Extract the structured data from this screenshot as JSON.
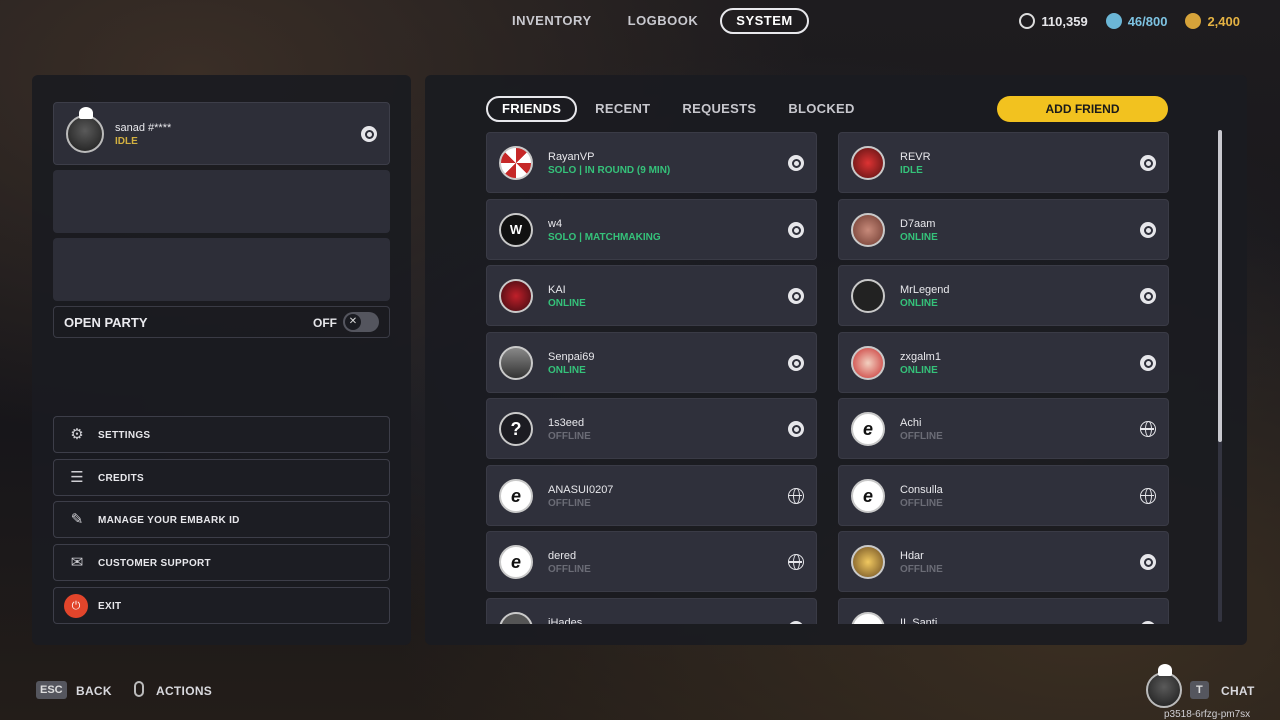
{
  "nav": {
    "tabs": [
      {
        "label": "INVENTORY",
        "active": false
      },
      {
        "label": "LOGBOOK",
        "active": false
      },
      {
        "label": "SYSTEM",
        "active": true
      }
    ]
  },
  "currencies": {
    "credits": {
      "value": "110,359",
      "icon": "coin-icon"
    },
    "capacity": {
      "value": "46/800",
      "icon": "storage-icon",
      "color": "#7ec3e2"
    },
    "premium": {
      "value": "2,400",
      "icon": "multibucks-icon",
      "color": "#e4b243"
    }
  },
  "party": {
    "player": {
      "name": "sanad #****",
      "status": "IDLE",
      "platform": "steam-icon"
    },
    "open_party_label": "OPEN PARTY",
    "open_party_state": "OFF",
    "toggle_icon": "✕"
  },
  "menu": [
    {
      "label": "SETTINGS",
      "icon": "⚙",
      "name": "settings-button",
      "icon_name": "gear-icon"
    },
    {
      "label": "CREDITS",
      "icon": "☰",
      "name": "credits-button",
      "icon_name": "list-icon"
    },
    {
      "label": "MANAGE YOUR EMBARK ID",
      "icon": "✎",
      "name": "manage-embark-id-button",
      "icon_name": "pen-icon"
    },
    {
      "label": "CUSTOMER SUPPORT",
      "icon": "✉",
      "name": "customer-support-button",
      "icon_name": "chat-bubbles-icon"
    },
    {
      "label": "EXIT",
      "icon": "⏻",
      "name": "exit-button",
      "icon_name": "power-icon"
    }
  ],
  "friends_tabs": [
    {
      "label": "FRIENDS",
      "active": true
    },
    {
      "label": "RECENT",
      "active": false
    },
    {
      "label": "REQUESTS",
      "active": false
    },
    {
      "label": "BLOCKED",
      "active": false
    }
  ],
  "add_friend_label": "ADD FRIEND",
  "friends": [
    {
      "name": "RayanVP",
      "status": "SOLO | IN ROUND (9 MIN)",
      "state": "online",
      "platform": "steam",
      "avatar": "umbrella",
      "glyph": ""
    },
    {
      "name": "REVR",
      "status": "IDLE",
      "state": "idle",
      "platform": "steam",
      "avatar": "revr",
      "glyph": ""
    },
    {
      "name": "w4",
      "status": "SOLO | MATCHMAKING",
      "state": "online",
      "platform": "steam",
      "avatar": "w4",
      "glyph": "W"
    },
    {
      "name": "D7aam",
      "status": "ONLINE",
      "state": "online",
      "platform": "steam",
      "avatar": "d7",
      "glyph": ""
    },
    {
      "name": "KAI",
      "status": "ONLINE",
      "state": "online",
      "platform": "steam",
      "avatar": "kai",
      "glyph": ""
    },
    {
      "name": "MrLegend",
      "status": "ONLINE",
      "state": "online",
      "platform": "steam",
      "avatar": "mr",
      "glyph": ""
    },
    {
      "name": "Senpai69",
      "status": "ONLINE",
      "state": "online",
      "platform": "steam",
      "avatar": "senpai",
      "glyph": ""
    },
    {
      "name": "zxgalm1",
      "status": "ONLINE",
      "state": "online",
      "platform": "steam",
      "avatar": "zx",
      "glyph": ""
    },
    {
      "name": "1s3eed",
      "status": "OFFLINE",
      "state": "offline",
      "platform": "steam",
      "avatar": "q",
      "glyph": "?"
    },
    {
      "name": "Achi",
      "status": "OFFLINE",
      "state": "offline",
      "platform": "globe",
      "avatar": "e",
      "glyph": "e"
    },
    {
      "name": "ANASUI0207",
      "status": "OFFLINE",
      "state": "offline",
      "platform": "globe",
      "avatar": "e",
      "glyph": "e"
    },
    {
      "name": "Consulla",
      "status": "OFFLINE",
      "state": "offline",
      "platform": "globe",
      "avatar": "e",
      "glyph": "e"
    },
    {
      "name": "dered",
      "status": "OFFLINE",
      "state": "offline",
      "platform": "globe",
      "avatar": "e",
      "glyph": "e"
    },
    {
      "name": "Hdar",
      "status": "OFFLINE",
      "state": "offline",
      "platform": "steam",
      "avatar": "hdar",
      "glyph": ""
    },
    {
      "name": "iHades",
      "status": "",
      "state": "offline",
      "platform": "steam",
      "avatar": "ih",
      "glyph": ""
    },
    {
      "name": "II_Santi",
      "status": "",
      "state": "offline",
      "platform": "steam",
      "avatar": "e",
      "glyph": "e"
    }
  ],
  "bottom": {
    "back_key": "ESC",
    "back_label": "BACK",
    "actions_label": "ACTIONS",
    "chat_key": "T",
    "chat_label": "CHAT",
    "build_id": "p3518-6rfzg-pm7sx"
  }
}
